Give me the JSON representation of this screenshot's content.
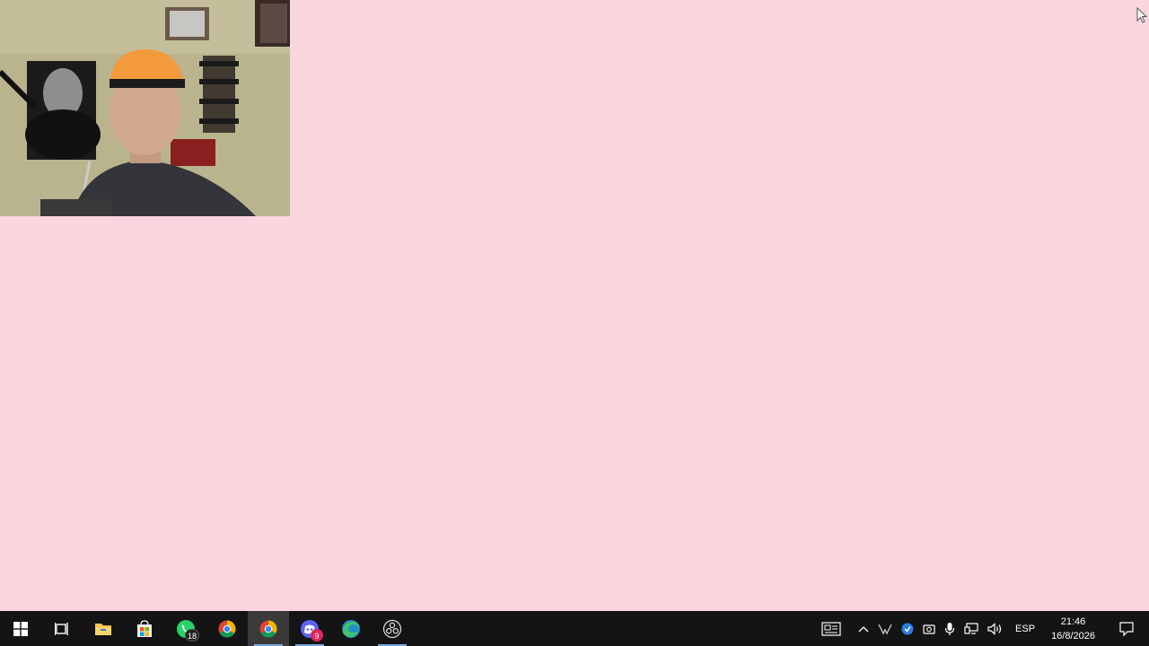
{
  "desktop": {
    "background": "#f9d5de"
  },
  "webcam": {
    "description_visible": false
  },
  "taskbar": {
    "background": "#141414",
    "buttons": [
      {
        "name": "start",
        "icon": "windows-icon"
      },
      {
        "name": "task-view",
        "icon": "task-view-icon"
      },
      {
        "name": "file-explorer",
        "icon": "folder-icon"
      },
      {
        "name": "store",
        "icon": "store-icon"
      },
      {
        "name": "whatsapp",
        "icon": "whatsapp-icon",
        "badge": "18"
      },
      {
        "name": "chrome",
        "icon": "chrome-icon"
      },
      {
        "name": "chrome-profile",
        "icon": "chrome-icon"
      },
      {
        "name": "discord",
        "icon": "discord-icon",
        "badge": "9"
      },
      {
        "name": "edge",
        "icon": "edge-icon"
      },
      {
        "name": "obs",
        "icon": "obs-icon"
      }
    ],
    "tray": {
      "language": "ESP",
      "time": "21:46",
      "date": "16/8/2026"
    }
  }
}
